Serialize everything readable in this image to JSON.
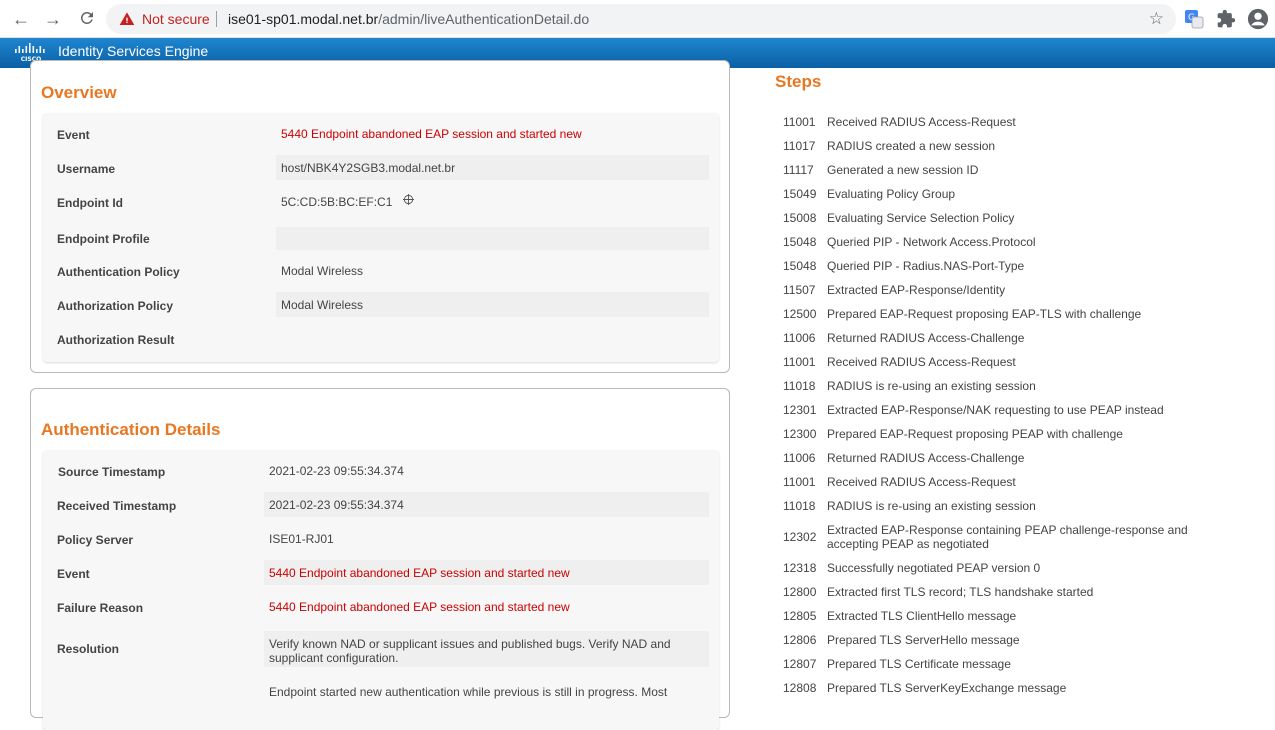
{
  "browser": {
    "not_secure": "Not secure",
    "url_host": "ise01-sp01.modal.net.br",
    "url_path": "/admin/liveAuthenticationDetail.do"
  },
  "app": {
    "title": "Identity Services Engine"
  },
  "overview": {
    "title": "Overview",
    "rows": [
      {
        "label": "Event",
        "value": "5440 Endpoint abandoned EAP session and started new"
      },
      {
        "label": "Username",
        "value": "host/NBK4Y2SGB3.modal.net.br"
      },
      {
        "label": "Endpoint Id",
        "value": "5C:CD:5B:BC:EF:C1"
      },
      {
        "label": "Endpoint Profile",
        "value": ""
      },
      {
        "label": "Authentication Policy",
        "value": "Modal Wireless"
      },
      {
        "label": "Authorization Policy",
        "value": "Modal Wireless"
      },
      {
        "label": "Authorization Result",
        "value": ""
      }
    ]
  },
  "auth_details": {
    "title": "Authentication Details",
    "rows": [
      {
        "label": "Source Timestamp",
        "value": "2021-02-23 09:55:34.374"
      },
      {
        "label": "Received Timestamp",
        "value": "2021-02-23 09:55:34.374"
      },
      {
        "label": "Policy Server",
        "value": "ISE01-RJ01"
      },
      {
        "label": "Event",
        "value": "5440 Endpoint abandoned EAP session and started new"
      },
      {
        "label": "Failure Reason",
        "value": "5440 Endpoint abandoned EAP session and started new"
      },
      {
        "label": "Resolution",
        "value": "Verify known NAD or supplicant issues and published bugs. Verify NAD and supplicant configuration."
      },
      {
        "label": "",
        "value": "Endpoint started new authentication while previous is still in progress. Most"
      }
    ]
  },
  "steps": {
    "title": "Steps",
    "items": [
      {
        "code": "11001",
        "desc": "Received RADIUS Access-Request"
      },
      {
        "code": "11017",
        "desc": "RADIUS created a new session"
      },
      {
        "code": "11117",
        "desc": "Generated a new session ID"
      },
      {
        "code": "15049",
        "desc": "Evaluating Policy Group"
      },
      {
        "code": "15008",
        "desc": "Evaluating Service Selection Policy"
      },
      {
        "code": "15048",
        "desc": "Queried PIP - Network Access.Protocol"
      },
      {
        "code": "15048",
        "desc": "Queried PIP - Radius.NAS-Port-Type"
      },
      {
        "code": "11507",
        "desc": "Extracted EAP-Response/Identity"
      },
      {
        "code": "12500",
        "desc": "Prepared EAP-Request proposing EAP-TLS with challenge"
      },
      {
        "code": "11006",
        "desc": "Returned RADIUS Access-Challenge"
      },
      {
        "code": "11001",
        "desc": "Received RADIUS Access-Request"
      },
      {
        "code": "11018",
        "desc": "RADIUS is re-using an existing session"
      },
      {
        "code": "12301",
        "desc": "Extracted EAP-Response/NAK requesting to use PEAP instead"
      },
      {
        "code": "12300",
        "desc": "Prepared EAP-Request proposing PEAP with challenge"
      },
      {
        "code": "11006",
        "desc": "Returned RADIUS Access-Challenge"
      },
      {
        "code": "11001",
        "desc": "Received RADIUS Access-Request"
      },
      {
        "code": "11018",
        "desc": "RADIUS is re-using an existing session"
      },
      {
        "code": "12302",
        "desc": "Extracted EAP-Response containing PEAP challenge-response and accepting PEAP as negotiated"
      },
      {
        "code": "12318",
        "desc": "Successfully negotiated PEAP version 0"
      },
      {
        "code": "12800",
        "desc": "Extracted first TLS record; TLS handshake started"
      },
      {
        "code": "12805",
        "desc": "Extracted TLS ClientHello message"
      },
      {
        "code": "12806",
        "desc": "Prepared TLS ServerHello message"
      },
      {
        "code": "12807",
        "desc": "Prepared TLS Certificate message"
      },
      {
        "code": "12808",
        "desc": "Prepared TLS ServerKeyExchange message"
      }
    ]
  },
  "colors": {
    "accent": "#e87722",
    "error": "#cc0000",
    "brand_bar": "#0b5fa5"
  }
}
